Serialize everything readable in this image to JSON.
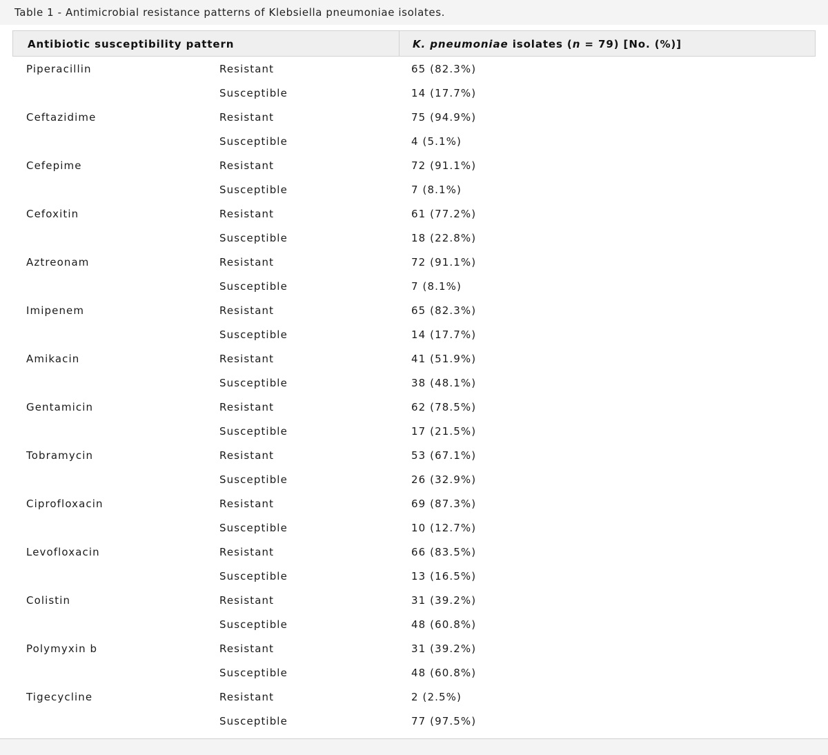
{
  "caption": "Table 1 - Antimicrobial resistance patterns of Klebsiella pneumoniae isolates.",
  "header": {
    "col1": "Antibiotic susceptibility pattern",
    "col2_italic_prefix": "K. pneumoniae",
    "col2_mid": " isolates (",
    "col2_italic_n": "n",
    "col2_suffix": " = 79) [No. (%)]"
  },
  "rows": [
    {
      "drug": "Piperacillin",
      "pattern": "Resistant",
      "value": "65 (82.3%)"
    },
    {
      "drug": "",
      "pattern": "Susceptible",
      "value": "14 (17.7%)"
    },
    {
      "drug": "Ceftazidime",
      "pattern": "Resistant",
      "value": "75 (94.9%)"
    },
    {
      "drug": "",
      "pattern": "Susceptible",
      "value": "4 (5.1%)"
    },
    {
      "drug": "Cefepime",
      "pattern": "Resistant",
      "value": "72 (91.1%)"
    },
    {
      "drug": "",
      "pattern": "Susceptible",
      "value": "7 (8.1%)"
    },
    {
      "drug": "Cefoxitin",
      "pattern": "Resistant",
      "value": "61 (77.2%)"
    },
    {
      "drug": "",
      "pattern": "Susceptible",
      "value": "18 (22.8%)"
    },
    {
      "drug": "Aztreonam",
      "pattern": "Resistant",
      "value": "72 (91.1%)"
    },
    {
      "drug": "",
      "pattern": "Susceptible",
      "value": "7 (8.1%)"
    },
    {
      "drug": "Imipenem",
      "pattern": "Resistant",
      "value": "65 (82.3%)"
    },
    {
      "drug": "",
      "pattern": "Susceptible",
      "value": "14 (17.7%)"
    },
    {
      "drug": "Amikacin",
      "pattern": "Resistant",
      "value": "41 (51.9%)"
    },
    {
      "drug": "",
      "pattern": "Susceptible",
      "value": "38 (48.1%)"
    },
    {
      "drug": "Gentamicin",
      "pattern": "Resistant",
      "value": "62 (78.5%)"
    },
    {
      "drug": "",
      "pattern": "Susceptible",
      "value": "17 (21.5%)"
    },
    {
      "drug": "Tobramycin",
      "pattern": "Resistant",
      "value": "53 (67.1%)"
    },
    {
      "drug": "",
      "pattern": "Susceptible",
      "value": "26 (32.9%)"
    },
    {
      "drug": "Ciprofloxacin",
      "pattern": "Resistant",
      "value": "69 (87.3%)"
    },
    {
      "drug": "",
      "pattern": "Susceptible",
      "value": "10 (12.7%)"
    },
    {
      "drug": "Levofloxacin",
      "pattern": "Resistant",
      "value": "66 (83.5%)"
    },
    {
      "drug": "",
      "pattern": "Susceptible",
      "value": "13 (16.5%)"
    },
    {
      "drug": "Colistin",
      "pattern": "Resistant",
      "value": "31 (39.2%)"
    },
    {
      "drug": "",
      "pattern": "Susceptible",
      "value": "48 (60.8%)"
    },
    {
      "drug": "Polymyxin b",
      "pattern": "Resistant",
      "value": "31 (39.2%)"
    },
    {
      "drug": "",
      "pattern": "Susceptible",
      "value": "48 (60.8%)"
    },
    {
      "drug": "Tigecycline",
      "pattern": "Resistant",
      "value": "2 (2.5%)"
    },
    {
      "drug": "",
      "pattern": "Susceptible",
      "value": "77 (97.5%)"
    }
  ]
}
